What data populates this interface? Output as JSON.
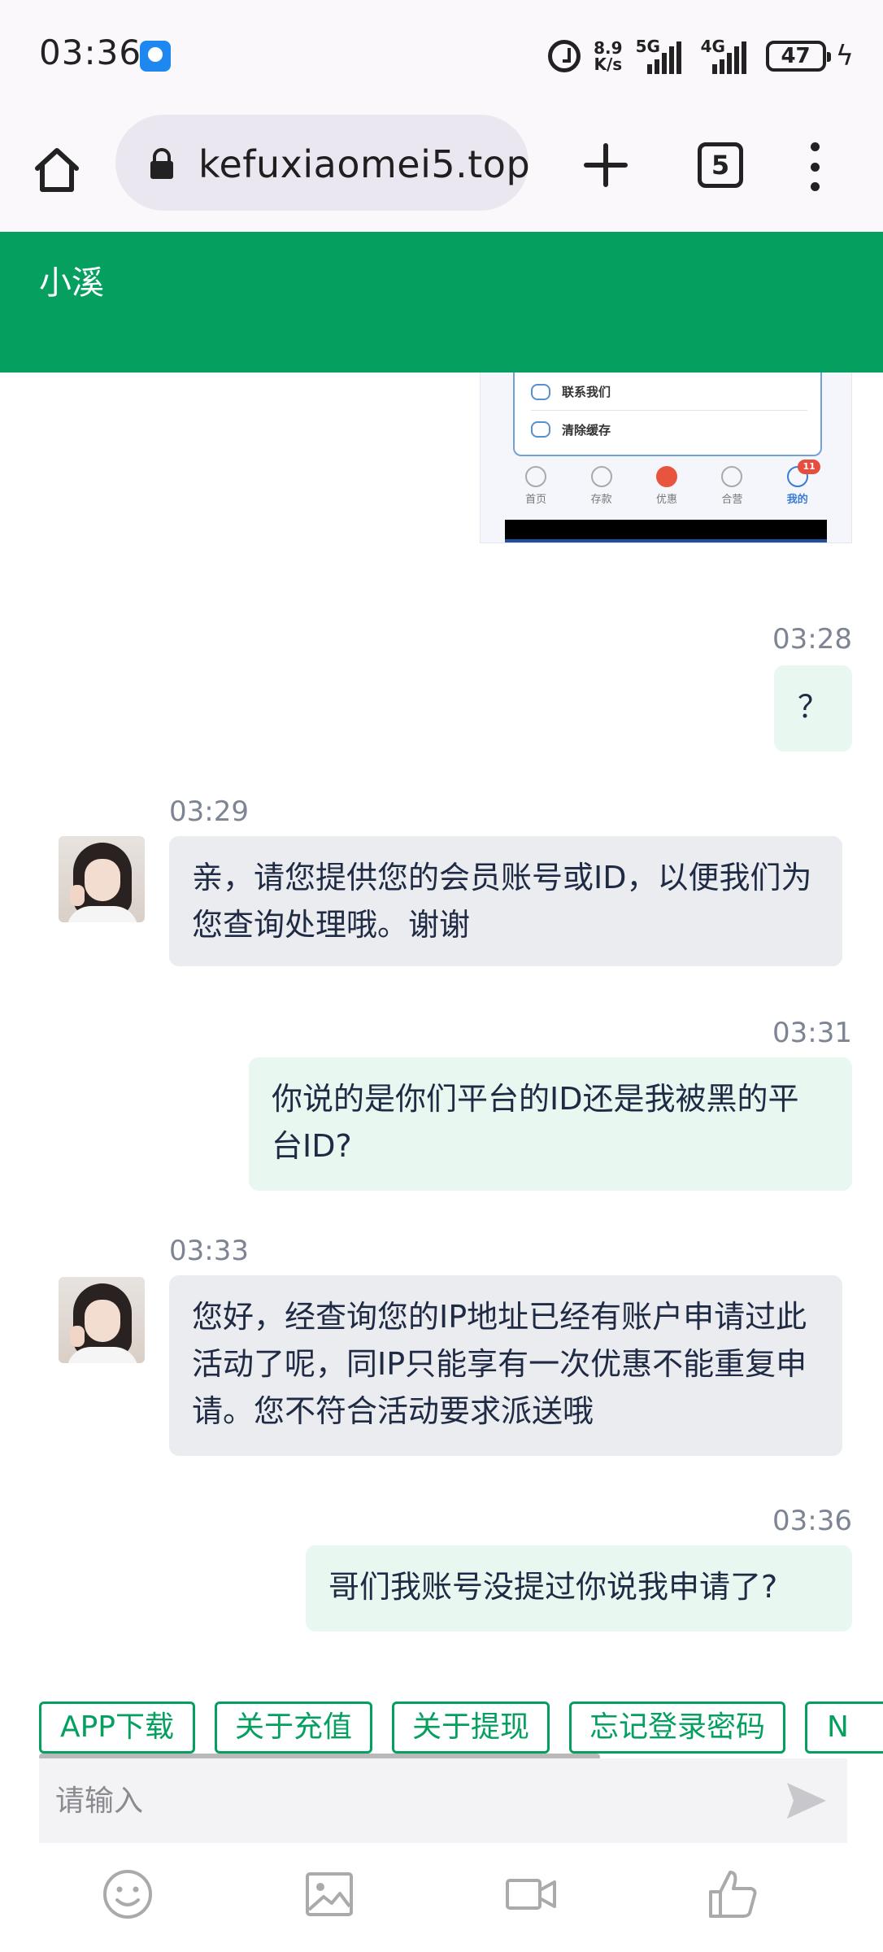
{
  "status_bar": {
    "time": "03:36",
    "net_speed_value": "8.9",
    "net_speed_unit": "K/s",
    "net1_label": "5G",
    "net2_label": "4G",
    "battery": "47"
  },
  "browser": {
    "url": "kefuxiaomei5.top",
    "tab_count": "5"
  },
  "chat": {
    "title": "小溪",
    "image_message": {
      "row1": "联系我们",
      "row2": "清除缓存",
      "nav": [
        "首页",
        "存款",
        "优惠",
        "合营",
        "我的"
      ],
      "badge": "11"
    },
    "messages": [
      {
        "time": "03:28",
        "text": "？"
      },
      {
        "time": "03:29",
        "text": "亲，请您提供您的会员账号或ID，以便我们为您查询处理哦。谢谢"
      },
      {
        "time": "03:31",
        "text": "你说的是你们平台的ID还是我被黑的平台ID?"
      },
      {
        "time": "03:33",
        "text": "您好，经查询您的IP地址已经有账户申请过此活动了呢，同IP只能享有一次优惠不能重复申请。您不符合活动要求派送哦"
      },
      {
        "time": "03:36",
        "text": "哥们我账号没提过你说我申请了?"
      }
    ]
  },
  "quick_replies": [
    "APP下载",
    "关于充值",
    "关于提现",
    "忘记登录密码",
    "N"
  ],
  "input": {
    "placeholder": "请输入"
  },
  "colors": {
    "brand": "#059f5f",
    "me_bubble": "#e8f7f0",
    "them_bubble": "#ebecef"
  }
}
